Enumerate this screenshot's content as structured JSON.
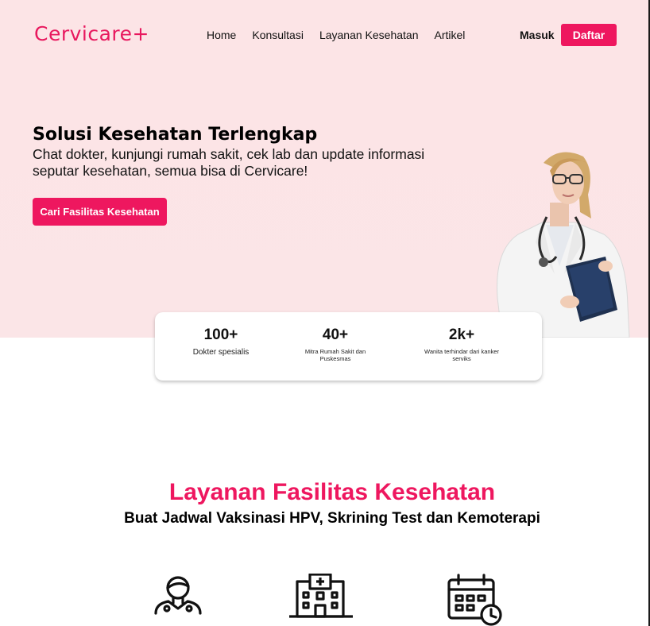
{
  "header": {
    "logo": "Cervicare+",
    "nav": [
      "Home",
      "Konsultasi",
      "Layanan Kesehatan",
      "Artikel"
    ],
    "login_label": "Masuk",
    "register_label": "Daftar"
  },
  "hero": {
    "title": "Solusi Kesehatan Terlengkap",
    "subtitle": "Chat dokter, kunjungi rumah sakit, cek lab dan update informasi seputar kesehatan, semua bisa di Cervicare!",
    "cta_label": "Cari Fasilitas Kesehatan"
  },
  "stats": [
    {
      "value": "100+",
      "label": "Dokter spesialis"
    },
    {
      "value": "40+",
      "label": "Mitra Rumah Sakit dan Puskesmas"
    },
    {
      "value": "2k+",
      "label": "Wanita terhindar dari kanker serviks"
    }
  ],
  "services": {
    "title": "Layanan Fasilitas Kesehatan",
    "subtitle": "Buat Jadwal Vaksinasi HPV, Skrining Test dan Kemoterapi",
    "icons": [
      "doctor-icon",
      "hospital-icon",
      "calendar-clock-icon"
    ]
  },
  "colors": {
    "accent": "#ee175f",
    "hero_bg": "#fce4e6"
  }
}
